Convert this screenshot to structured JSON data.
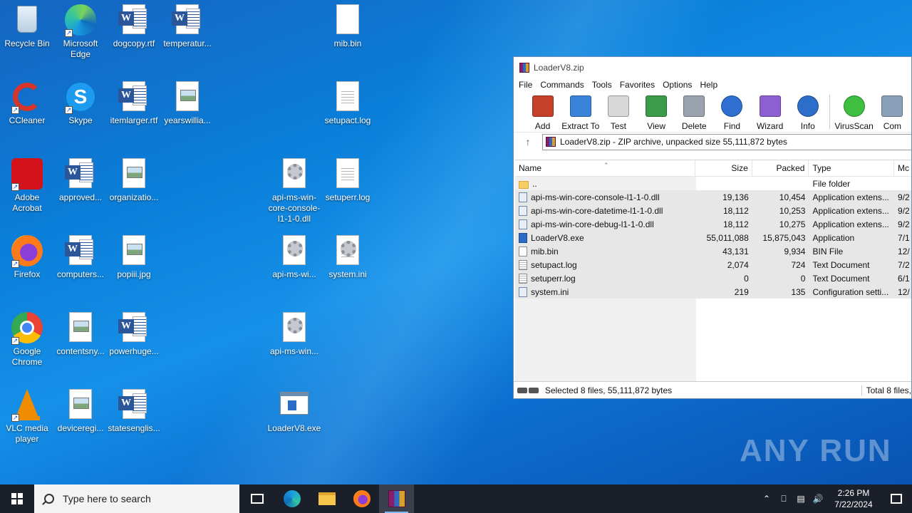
{
  "desktop": {
    "icons": [
      {
        "label": "Recycle Bin",
        "icon": "recycle-bin-icon"
      },
      {
        "label": "Microsoft Edge",
        "icon": "edge-icon"
      },
      {
        "label": "dogcopy.rtf",
        "icon": "word-document-icon"
      },
      {
        "label": "temperatur...",
        "icon": "word-document-icon"
      },
      {
        "label": "mib.bin",
        "icon": "blank-file-icon"
      },
      {
        "label": "CCleaner",
        "icon": "ccleaner-icon"
      },
      {
        "label": "Skype",
        "icon": "skype-icon"
      },
      {
        "label": "itemlarger.rtf",
        "icon": "word-document-icon"
      },
      {
        "label": "yearswillia...",
        "icon": "image-file-icon"
      },
      {
        "label": "setupact.log",
        "icon": "text-file-icon"
      },
      {
        "label": "Adobe Acrobat",
        "icon": "acrobat-icon"
      },
      {
        "label": "approved...",
        "icon": "word-document-icon"
      },
      {
        "label": "organizatio...",
        "icon": "image-file-icon"
      },
      {
        "label": "api-ms-win-core-console-l1-1-0.dll",
        "icon": "dll-file-icon"
      },
      {
        "label": "setuperr.log",
        "icon": "text-file-icon"
      },
      {
        "label": "Firefox",
        "icon": "firefox-icon"
      },
      {
        "label": "computers...",
        "icon": "word-document-icon"
      },
      {
        "label": "popiii.jpg",
        "icon": "image-file-icon"
      },
      {
        "label": "api-ms-wi...",
        "icon": "dll-file-icon"
      },
      {
        "label": "system.ini",
        "icon": "ini-file-icon"
      },
      {
        "label": "Google Chrome",
        "icon": "chrome-icon"
      },
      {
        "label": "contentsny...",
        "icon": "image-file-icon"
      },
      {
        "label": "powerhuge...",
        "icon": "word-document-icon"
      },
      {
        "label": "api-ms-win...",
        "icon": "dll-file-icon"
      },
      {
        "label": "VLC media player",
        "icon": "vlc-icon"
      },
      {
        "label": "deviceregi...",
        "icon": "image-file-icon"
      },
      {
        "label": "statesenglis...",
        "icon": "word-document-icon"
      },
      {
        "label": "LoaderV8.exe",
        "icon": "exe-file-icon"
      }
    ]
  },
  "winrar": {
    "title": "LoaderV8.zip",
    "menu": [
      "File",
      "Commands",
      "Tools",
      "Favorites",
      "Options",
      "Help"
    ],
    "toolbar": [
      {
        "label": "Add",
        "icon": "add-icon"
      },
      {
        "label": "Extract To",
        "icon": "extract-to-icon"
      },
      {
        "label": "Test",
        "icon": "test-icon"
      },
      {
        "label": "View",
        "icon": "view-icon"
      },
      {
        "label": "Delete",
        "icon": "delete-icon"
      },
      {
        "label": "Find",
        "icon": "find-icon"
      },
      {
        "label": "Wizard",
        "icon": "wizard-icon"
      },
      {
        "label": "Info",
        "icon": "info-icon"
      },
      {
        "label": "VirusScan",
        "icon": "virusscan-icon"
      },
      {
        "label": "Com",
        "icon": "comment-icon"
      }
    ],
    "address": "LoaderV8.zip - ZIP archive, unpacked size 55,111,872 bytes",
    "columns": {
      "name": "Name",
      "size": "Size",
      "packed": "Packed",
      "type": "Type",
      "modified": "Mc"
    },
    "files": [
      {
        "name": "..",
        "size": "",
        "packed": "",
        "type": "File folder",
        "modified": "",
        "kind": "folder"
      },
      {
        "name": "api-ms-win-core-console-l1-1-0.dll",
        "size": "19,136",
        "packed": "10,454",
        "type": "Application extens...",
        "modified": "9/2",
        "kind": "dll"
      },
      {
        "name": "api-ms-win-core-datetime-l1-1-0.dll",
        "size": "18,112",
        "packed": "10,253",
        "type": "Application extens...",
        "modified": "9/2",
        "kind": "dll"
      },
      {
        "name": "api-ms-win-core-debug-l1-1-0.dll",
        "size": "18,112",
        "packed": "10,275",
        "type": "Application extens...",
        "modified": "9/2",
        "kind": "dll"
      },
      {
        "name": "LoaderV8.exe",
        "size": "55,011,088",
        "packed": "15,875,043",
        "type": "Application",
        "modified": "7/1",
        "kind": "exe"
      },
      {
        "name": "mib.bin",
        "size": "43,131",
        "packed": "9,934",
        "type": "BIN File",
        "modified": "12/",
        "kind": "file"
      },
      {
        "name": "setupact.log",
        "size": "2,074",
        "packed": "724",
        "type": "Text Document",
        "modified": "7/2",
        "kind": "txt"
      },
      {
        "name": "setuperr.log",
        "size": "0",
        "packed": "0",
        "type": "Text Document",
        "modified": "6/1",
        "kind": "txt"
      },
      {
        "name": "system.ini",
        "size": "219",
        "packed": "135",
        "type": "Configuration setti...",
        "modified": "12/",
        "kind": "dll"
      }
    ],
    "status_left": "Selected 8 files, 55,111,872 bytes",
    "status_right": "Total 8 files,"
  },
  "watermark": "ANY RUN",
  "taskbar": {
    "search_placeholder": "Type here to search",
    "time": "2:26 PM",
    "date": "7/22/2024"
  }
}
